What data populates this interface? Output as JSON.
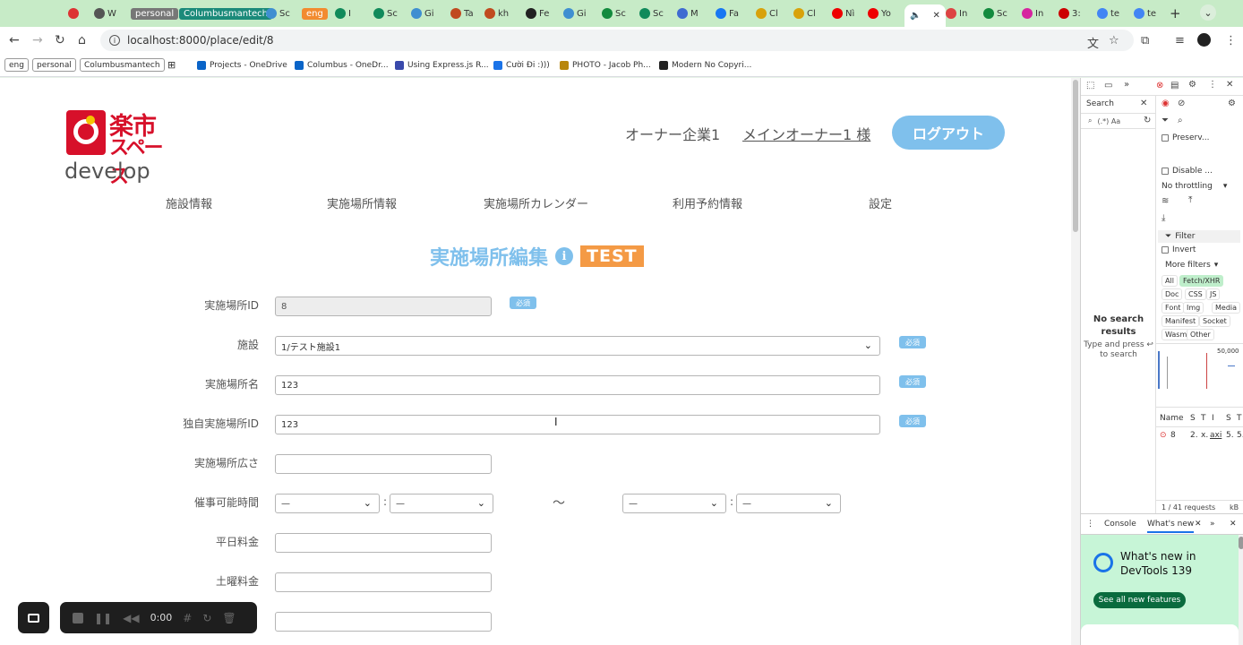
{
  "browser": {
    "tabs": [
      {
        "label": "W",
        "color": "#555"
      },
      {
        "label": "personal",
        "pill": "#777"
      },
      {
        "label": "Columbusmantech",
        "pill": "#1b8a7a"
      },
      {
        "label": "Sc",
        "color": "#3f8fd1"
      },
      {
        "label": "eng",
        "pill": "#f28b30"
      },
      {
        "label": "I",
        "color": "#118a5b"
      },
      {
        "label": "Sc",
        "color": "#118a5b"
      },
      {
        "label": "Gi",
        "color": "#3f8fd1"
      },
      {
        "label": "Ta",
        "color": "#c04a1f"
      },
      {
        "label": "kh",
        "color": "#c04a1f"
      },
      {
        "label": "Fe",
        "color": "#222"
      },
      {
        "label": "Gi",
        "color": "#3f8fd1"
      },
      {
        "label": "Sc",
        "color": "#138a3e"
      },
      {
        "label": "Sc",
        "color": "#118a5b"
      },
      {
        "label": "M",
        "color": "#3f6bd1"
      },
      {
        "label": "Fa",
        "color": "#1877f2"
      },
      {
        "label": "Cl",
        "color": "#d8a20b"
      },
      {
        "label": "Cl",
        "color": "#d8a20b"
      },
      {
        "label": "Nì",
        "color": "#e00"
      },
      {
        "label": "Yo",
        "color": "#e00"
      },
      {
        "label": "In",
        "color": "#d44"
      },
      {
        "label": "Sc",
        "color": "#138a3e"
      },
      {
        "label": "In",
        "color": "#d6249f"
      },
      {
        "label": "3:",
        "color": "#c00"
      },
      {
        "label": "te",
        "color": "#4285f4"
      },
      {
        "label": "te",
        "color": "#4285f4"
      }
    ],
    "url": "localhost:8000/place/edit/8",
    "bookmarks": [
      {
        "label": "eng",
        "pill": true
      },
      {
        "label": "personal",
        "pill": true
      },
      {
        "label": "Columbusmantech",
        "pill": true
      },
      {
        "label": "Projects - OneDrive",
        "color": "#0a64c8"
      },
      {
        "label": "Columbus - OneDr...",
        "color": "#0a64c8"
      },
      {
        "label": "Using Express.js R...",
        "color": "#3949ab"
      },
      {
        "label": "Cười Đi :)))",
        "color": "#1a73e8"
      },
      {
        "label": "PHOTO - Jacob Ph...",
        "color": "#b8860b"
      },
      {
        "label": "Modern No Copyri...",
        "color": "#222"
      }
    ]
  },
  "header": {
    "logo_main": "楽市",
    "logo_sub_text": "スペース",
    "env_label": "develop",
    "company": "オーナー企業1",
    "owner": "メインオーナー1 様",
    "logout": "ログアウト"
  },
  "nav": [
    "施設情報",
    "実施場所情報",
    "実施場所カレンダー",
    "利用予約情報",
    "設定"
  ],
  "title": {
    "text": "実施場所編集",
    "info_icon": "i",
    "badge": "TEST"
  },
  "form": {
    "required_label": "必須",
    "place_id_label": "実施場所ID",
    "place_id_value": "8",
    "facility_label": "施設",
    "facility_value": "1/テスト施設1",
    "place_name_label": "実施場所名",
    "place_name_value": "123",
    "own_place_id_label": "独自実施場所ID",
    "own_place_id_value": "123",
    "area_label": "実施場所広さ",
    "area_value": "",
    "hours_label": "催事可能時間",
    "hours_start_h": "—",
    "hours_start_m": "—",
    "hours_end_h": "—",
    "hours_end_m": "—",
    "colon": ":",
    "tilde": "〜",
    "weekday_fee_label": "平日料金",
    "saturday_fee_label": "土曜料金"
  },
  "recorder": {
    "time": "0:00"
  },
  "devtools": {
    "search_tab": "Search",
    "search_opts": "(.*) Aa",
    "no_results": "No search results",
    "no_results_hint": "Type and press ↩ to search",
    "preserve_log": "Preserv...",
    "disable_cache": "Disable ...",
    "throttling": "No throttling",
    "filter": "Filter",
    "invert": "Invert",
    "more_filters": "More filters",
    "chips": [
      "All",
      "Fetch/XHR",
      "Doc",
      "CSS",
      "JS",
      "Font",
      "Img",
      "Media",
      "Manifest",
      "Socket",
      "Wasm",
      "Other"
    ],
    "timeline_label": "50,000",
    "col_name": "Name",
    "cols": [
      "S",
      "T",
      "I",
      "S",
      "T"
    ],
    "row_name": "8",
    "row_cells": [
      "2.",
      "x.",
      "axi",
      "5.",
      "5."
    ],
    "requests": "1 / 41 requests",
    "kb": "kB",
    "console_tab": "Console",
    "whats_new_tab": "What's new",
    "whats_new_title": "What's new in DevTools 139",
    "whats_new_btn": "See all new features"
  }
}
